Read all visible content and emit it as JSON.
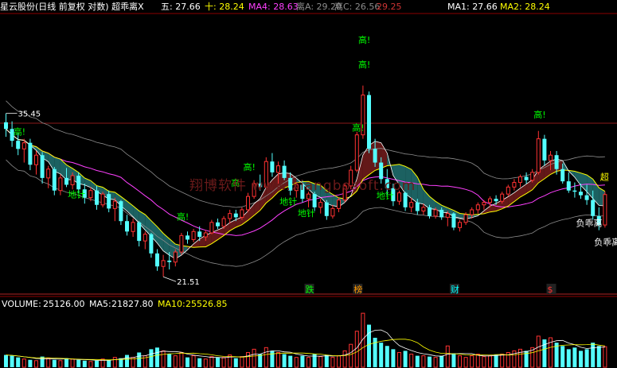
{
  "header": {
    "title": "星云股份(日线 前复权 对数) 超乖离X",
    "items": [
      {
        "label": "五:",
        "value": "27.66",
        "color": "#ffffff"
      },
      {
        "label": "十:",
        "value": "28.24",
        "color": "#ffff00"
      },
      {
        "label": "MA4:",
        "value": "28.63",
        "color": "#ff40ff"
      },
      {
        "label": "离A:",
        "value": "29.20",
        "color": "#8c8c8c"
      },
      {
        "label": "离C:",
        "value": "26.56",
        "color": "#8c8c8c"
      },
      {
        "label": "",
        "value": "29.25",
        "color": "#cc3333"
      },
      {
        "label": "MA1:",
        "value": "27.66",
        "color": "#ffffff"
      },
      {
        "label": "MA2:",
        "value": "28.24",
        "color": "#ffff00"
      }
    ]
  },
  "watermark": "翔博软件 www.xiangbosoft.com",
  "volume_header": {
    "volume_label": "VOLUME:",
    "volume_value": "25126.00",
    "ma5_label": "MA5:",
    "ma5_value": "21827.80",
    "ma10_label": "MA10:",
    "ma10_value": "25526.85"
  },
  "chart_data": {
    "type": "candlestick",
    "price_scale": "log",
    "ylim": [
      20.8,
      48
    ],
    "price_labels": {
      "high": "35.45",
      "low": "21.51"
    },
    "candles": [
      [
        34.5,
        35.45,
        33.0,
        33.8
      ],
      [
        33.8,
        34.6,
        32.0,
        32.6
      ],
      [
        32.6,
        33.4,
        31.2,
        31.8
      ],
      [
        31.8,
        32.8,
        30.5,
        32.4
      ],
      [
        32.4,
        32.8,
        29.8,
        30.3
      ],
      [
        30.3,
        31.6,
        29.4,
        31.2
      ],
      [
        31.2,
        31.5,
        28.6,
        29.1
      ],
      [
        29.1,
        30.2,
        28.2,
        29.9
      ],
      [
        29.9,
        30.1,
        27.6,
        28.0
      ],
      [
        28.0,
        29.4,
        27.6,
        29.1
      ],
      [
        29.1,
        30.0,
        28.3,
        28.5
      ],
      [
        28.5,
        29.6,
        28.1,
        29.3
      ],
      [
        29.3,
        29.6,
        27.8,
        28.1
      ],
      [
        28.1,
        28.6,
        26.9,
        27.4
      ],
      [
        27.4,
        28.3,
        27.1,
        28.0
      ],
      [
        28.0,
        28.4,
        26.4,
        26.8
      ],
      [
        26.8,
        27.9,
        26.6,
        27.7
      ],
      [
        27.7,
        28.0,
        26.2,
        26.5
      ],
      [
        26.5,
        27.4,
        25.5,
        27.1
      ],
      [
        27.1,
        27.2,
        25.2,
        25.5
      ],
      [
        25.5,
        26.0,
        24.4,
        24.7
      ],
      [
        24.7,
        25.7,
        24.3,
        25.4
      ],
      [
        25.4,
        25.5,
        23.6,
        24.0
      ],
      [
        24.0,
        24.7,
        23.4,
        24.5
      ],
      [
        24.5,
        24.6,
        22.8,
        23.1
      ],
      [
        23.1,
        23.4,
        21.9,
        22.2
      ],
      [
        22.2,
        23.0,
        21.51,
        22.6
      ],
      [
        22.6,
        23.2,
        22.0,
        22.5
      ],
      [
        22.5,
        23.4,
        22.2,
        23.2
      ],
      [
        23.2,
        24.6,
        23.0,
        24.4
      ],
      [
        24.4,
        24.7,
        23.8,
        24.1
      ],
      [
        24.1,
        24.9,
        23.9,
        24.7
      ],
      [
        24.7,
        25.1,
        24.0,
        24.3
      ],
      [
        24.3,
        24.8,
        24.0,
        24.6
      ],
      [
        24.6,
        25.6,
        24.5,
        25.4
      ],
      [
        25.4,
        25.7,
        24.9,
        25.1
      ],
      [
        25.1,
        25.9,
        24.9,
        25.7
      ],
      [
        25.7,
        26.4,
        25.3,
        26.1
      ],
      [
        26.1,
        26.4,
        25.5,
        25.8
      ],
      [
        25.8,
        26.6,
        25.6,
        26.4
      ],
      [
        26.4,
        27.8,
        26.2,
        27.5
      ],
      [
        27.5,
        28.9,
        27.3,
        28.6
      ],
      [
        28.6,
        29.4,
        28.0,
        28.3
      ],
      [
        28.3,
        31.0,
        28.2,
        30.6
      ],
      [
        30.6,
        31.4,
        29.2,
        29.6
      ],
      [
        29.6,
        30.6,
        28.6,
        30.2
      ],
      [
        30.2,
        30.7,
        28.9,
        29.1
      ],
      [
        29.1,
        29.6,
        27.6,
        28.0
      ],
      [
        28.0,
        28.7,
        27.4,
        28.5
      ],
      [
        28.5,
        28.9,
        27.0,
        27.3
      ],
      [
        27.3,
        27.9,
        26.6,
        27.7
      ],
      [
        27.7,
        27.9,
        26.3,
        26.6
      ],
      [
        26.6,
        27.3,
        26.1,
        27.0
      ],
      [
        27.0,
        27.2,
        25.6,
        25.9
      ],
      [
        25.9,
        26.8,
        25.7,
        26.5
      ],
      [
        26.5,
        27.4,
        26.2,
        27.2
      ],
      [
        27.2,
        28.6,
        27.0,
        28.4
      ],
      [
        28.4,
        30.2,
        28.1,
        29.8
      ],
      [
        29.8,
        33.5,
        29.6,
        33.2
      ],
      [
        33.2,
        38.6,
        32.8,
        37.5
      ],
      [
        37.5,
        37.9,
        31.4,
        31.8
      ],
      [
        31.8,
        32.8,
        30.1,
        30.5
      ],
      [
        30.5,
        31.0,
        28.6,
        29.0
      ],
      [
        29.0,
        29.9,
        27.6,
        28.2
      ],
      [
        28.2,
        28.6,
        26.7,
        27.1
      ],
      [
        27.1,
        28.0,
        26.8,
        27.8
      ],
      [
        27.8,
        27.9,
        26.3,
        26.6
      ],
      [
        26.6,
        27.4,
        26.2,
        27.0
      ],
      [
        27.0,
        27.3,
        26.0,
        26.3
      ],
      [
        26.3,
        26.9,
        26.0,
        26.6
      ],
      [
        26.6,
        26.8,
        25.7,
        25.9
      ],
      [
        25.9,
        26.6,
        25.7,
        26.4
      ],
      [
        26.4,
        26.6,
        25.6,
        25.8
      ],
      [
        25.8,
        26.3,
        25.1,
        26.1
      ],
      [
        26.1,
        26.2,
        24.8,
        25.0
      ],
      [
        25.0,
        25.6,
        24.7,
        25.4
      ],
      [
        25.4,
        26.2,
        25.2,
        26.0
      ],
      [
        26.0,
        26.6,
        25.7,
        26.4
      ],
      [
        26.4,
        27.0,
        26.1,
        26.8
      ],
      [
        26.8,
        27.2,
        26.4,
        27.0
      ],
      [
        27.0,
        27.5,
        26.6,
        27.3
      ],
      [
        27.3,
        27.6,
        26.8,
        27.1
      ],
      [
        27.1,
        27.9,
        26.9,
        27.7
      ],
      [
        27.7,
        28.5,
        27.5,
        28.3
      ],
      [
        28.3,
        29.0,
        28.0,
        28.7
      ],
      [
        28.7,
        29.4,
        28.3,
        29.2
      ],
      [
        29.2,
        29.6,
        28.6,
        28.9
      ],
      [
        28.9,
        29.9,
        28.7,
        29.6
      ],
      [
        29.6,
        33.6,
        29.4,
        32.8
      ],
      [
        32.8,
        33.2,
        30.2,
        30.7
      ],
      [
        30.7,
        31.6,
        29.8,
        31.2
      ],
      [
        31.2,
        31.6,
        29.4,
        29.9
      ],
      [
        29.9,
        30.4,
        28.6,
        28.8
      ],
      [
        28.8,
        29.6,
        27.8,
        28.0
      ],
      [
        28.0,
        28.7,
        27.4,
        27.9
      ],
      [
        27.9,
        28.6,
        27.3,
        27.6
      ],
      [
        27.6,
        28.5,
        26.8,
        27.2
      ],
      [
        27.2,
        28.0,
        25.6,
        25.9
      ],
      [
        25.9,
        26.6,
        24.8,
        25.2
      ],
      [
        25.2,
        27.9,
        25.0,
        27.66
      ]
    ],
    "indicator_labels": [
      {
        "text": "高!",
        "color": "#00ff00",
        "i": 2,
        "price": 33.2
      },
      {
        "text": "地针",
        "color": "#00ff00",
        "i": 11,
        "price": 27.4
      },
      {
        "text": "高!",
        "color": "#00ff00",
        "i": 29,
        "price": 25.6
      },
      {
        "text": "高!",
        "color": "#00ff00",
        "i": 40,
        "price": 29.8
      },
      {
        "text": "高",
        "color": "#00ff00",
        "i": 38,
        "price": 28.4
      },
      {
        "text": "地针",
        "color": "#00ff00",
        "i": 46,
        "price": 26.8
      },
      {
        "text": "地针",
        "color": "#00ff00",
        "i": 49,
        "price": 25.9
      },
      {
        "text": "高!",
        "color": "#00ff00",
        "i": 58,
        "price": 33.6
      },
      {
        "text": "高!",
        "color": "#00ff00",
        "i": 59,
        "price": 44.0
      },
      {
        "text": "高!",
        "color": "#00ff00",
        "i": 59,
        "price": 40.8
      },
      {
        "text": "地针",
        "color": "#00ff00",
        "i": 62,
        "price": 27.3
      },
      {
        "text": "高!",
        "color": "#00ff00",
        "i": 88,
        "price": 35.0
      },
      {
        "text": "负乖离",
        "color": "#ffffff",
        "i": 95,
        "price": 25.1
      },
      {
        "text": "负乖离",
        "color": "#ffffff",
        "i": 98,
        "price": 23.7
      },
      {
        "text": "超",
        "color": "#ffff00",
        "i": 99,
        "price": 28.9
      }
    ],
    "markers": [
      {
        "text": "跌",
        "color": "#00ff00",
        "i": 50
      },
      {
        "text": "榜",
        "color": "#ff9900",
        "i": 58
      },
      {
        "text": "财",
        "color": "#00ffff",
        "i": 74
      },
      {
        "text": "$",
        "color": "#ff3333",
        "i": 90
      }
    ],
    "volume": [
      15,
      14,
      12,
      10,
      9,
      8,
      13,
      11,
      9,
      8,
      11,
      10,
      9,
      8,
      7,
      8,
      10,
      9,
      12,
      11,
      15,
      12,
      18,
      14,
      22,
      24,
      20,
      16,
      14,
      18,
      12,
      14,
      11,
      10,
      13,
      12,
      12,
      15,
      11,
      13,
      18,
      22,
      16,
      24,
      20,
      18,
      16,
      14,
      12,
      14,
      12,
      16,
      13,
      15,
      12,
      14,
      20,
      28,
      44,
      66,
      52,
      36,
      30,
      26,
      22,
      18,
      20,
      16,
      14,
      14,
      13,
      12,
      14,
      26,
      17,
      14,
      12,
      14,
      16,
      13,
      14,
      15,
      16,
      18,
      20,
      22,
      20,
      24,
      38,
      34,
      36,
      30,
      26,
      22,
      24,
      20,
      22,
      30,
      26,
      25.1
    ],
    "volume_max": 70
  }
}
